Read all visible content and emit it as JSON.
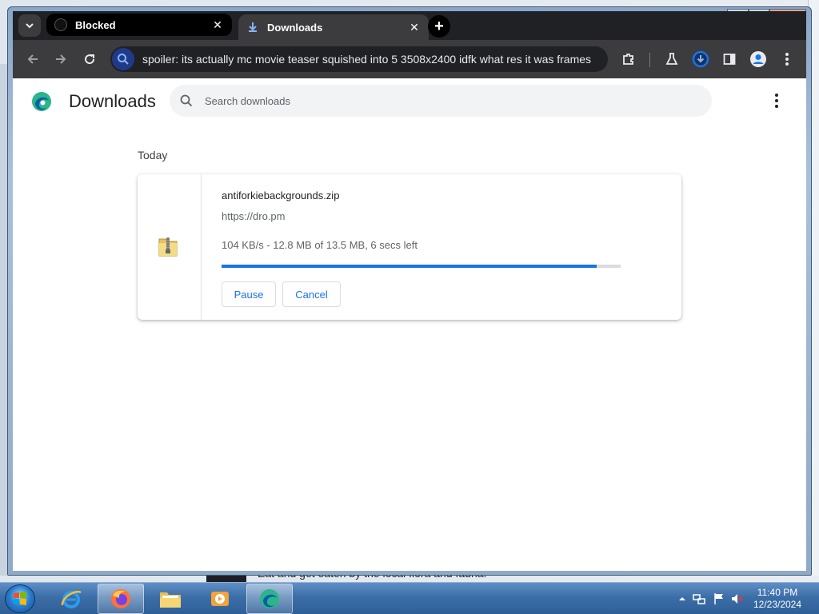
{
  "window": {
    "min_label": "",
    "max_label": "",
    "close_label": "✕"
  },
  "tabs": [
    {
      "title": "Blocked",
      "close": "✕"
    },
    {
      "title": "Downloads",
      "close": "✕"
    }
  ],
  "tab_search_glyph": "⌄",
  "new_tab_glyph": "+",
  "omnibox": {
    "text": "spoiler: its actually mc movie teaser squished into 5 3508x2400 idfk what res it was frames"
  },
  "page": {
    "title": "Downloads",
    "search_placeholder": "Search downloads",
    "date_group": "Today",
    "download": {
      "file_name": "antiforkiebackgrounds.zip",
      "url": "https://dro.pm",
      "status": "104 KB/s - 12.8 MB of 13.5 MB, 6 secs left",
      "progress_fraction": 0.94,
      "pause_label": "Pause",
      "cancel_label": "Cancel"
    }
  },
  "background": {
    "caption_text": "Eat and get eaten by the local flora and fauna."
  },
  "taskbar": {
    "apps": [
      "internet-explorer-icon",
      "firefox-icon",
      "file-explorer-icon",
      "media-player-icon",
      "browser-app-icon"
    ],
    "time": "11:40 PM",
    "date": "12/23/2024"
  },
  "colors": {
    "accent": "#1a73e8",
    "toolbar_bg": "#3c3c3f",
    "tabstrip_bg": "#202124"
  }
}
